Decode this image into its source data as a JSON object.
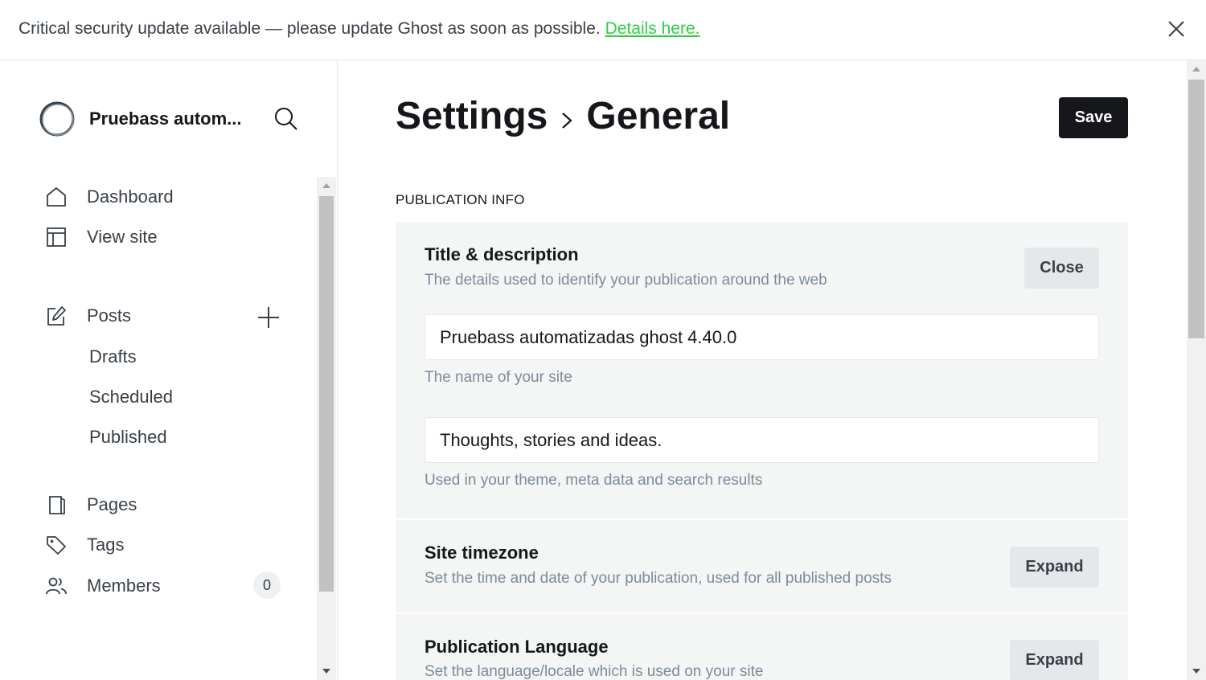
{
  "banner": {
    "message": "Critical security update available — please update Ghost as soon as possible.",
    "link_text": "Details here."
  },
  "sidebar": {
    "site_name": "Pruebass autom...",
    "nav": {
      "dashboard": "Dashboard",
      "view_site": "View site",
      "posts": "Posts",
      "drafts": "Drafts",
      "scheduled": "Scheduled",
      "published": "Published",
      "pages": "Pages",
      "tags": "Tags",
      "members": "Members",
      "members_count": "0"
    }
  },
  "header": {
    "crumb_parent": "Settings",
    "crumb_current": "General",
    "save_label": "Save"
  },
  "publication_info": {
    "section_label": "PUBLICATION INFO",
    "title_card": {
      "title": "Title & description",
      "description": "The details used to identify your publication around the web",
      "button": "Close",
      "site_title_value": "Pruebass automatizadas ghost 4.40.0",
      "site_title_hint": "The name of your site",
      "site_description_value": "Thoughts, stories and ideas.",
      "site_description_hint": "Used in your theme, meta data and search results"
    },
    "timezone_card": {
      "title": "Site timezone",
      "description": "Set the time and date of your publication, used for all published posts",
      "button": "Expand"
    },
    "language_card": {
      "title": "Publication Language",
      "description": "Set the language/locale which is used on your site",
      "button": "Expand"
    }
  },
  "colors": {
    "link_green": "#30cf43",
    "primary_dark": "#15171a",
    "muted_text": "#7c8b9a",
    "card_bg": "#f4f5f5"
  }
}
